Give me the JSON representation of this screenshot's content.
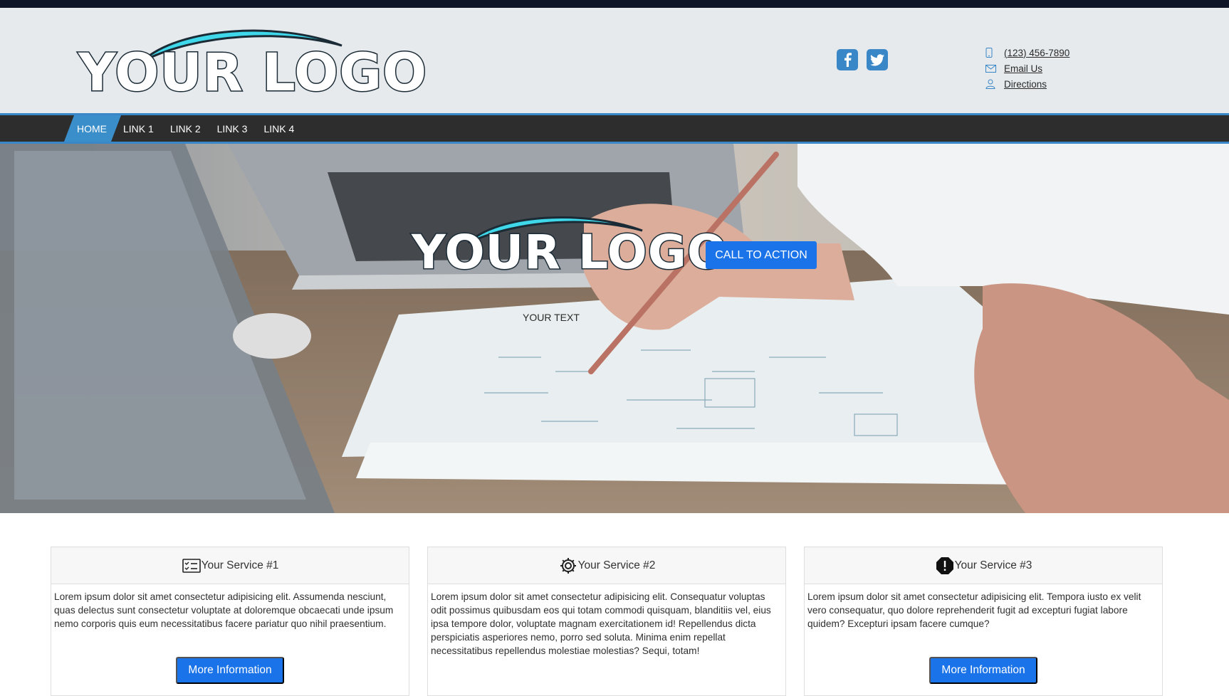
{
  "brand": {
    "logo_text": "YOUR LOGO",
    "accent_color": "#3a87c8",
    "swoosh_color": "#3fd8ea"
  },
  "header": {
    "social": [
      {
        "name": "facebook",
        "icon": "facebook-icon"
      },
      {
        "name": "twitter",
        "icon": "twitter-icon"
      }
    ],
    "contact": {
      "phone": "(123) 456-7890",
      "email": "Email Us",
      "directions": "Directions"
    }
  },
  "nav": {
    "links": [
      "HOME",
      "LINK 1",
      "LINK 2",
      "LINK 3",
      "LINK 4"
    ],
    "active": "HOME"
  },
  "hero": {
    "cta_label": "CALL TO ACTION",
    "text": "YOUR TEXT"
  },
  "services": [
    {
      "title": "Your Service #1",
      "icon": "checklist-icon",
      "body": "Lorem ipsum dolor sit amet consectetur adipisicing elit. Assumenda nesciunt, quas delectus sunt consectetur voluptate at doloremque obcaecati unde ipsum nemo corporis quis eum necessitatibus facere pariatur quo nihil praesentium.",
      "button": "More Information"
    },
    {
      "title": "Your Service #2",
      "icon": "gear-icon",
      "body": "Lorem ipsum dolor sit amet consectetur adipisicing elit. Consequatur voluptas odit possimus quibusdam eos qui totam commodi quisquam, blanditiis vel, eius ipsa tempore dolor, voluptate magnam exercitationem id! Repellendus dicta perspiciatis asperiores nemo, porro sed soluta. Minima enim repellat necessitatibus repellendus molestiae molestias? Sequi, totam!",
      "button": ""
    },
    {
      "title": "Your Service #3",
      "icon": "alert-octagon-icon",
      "body": "Lorem ipsum dolor sit amet consectetur adipisicing elit. Tempora iusto ex velit vero consequatur, quo dolore reprehenderit fugit ad excepturi fugiat labore quidem? Excepturi ipsam facere cumque?",
      "button": "More Information"
    }
  ]
}
